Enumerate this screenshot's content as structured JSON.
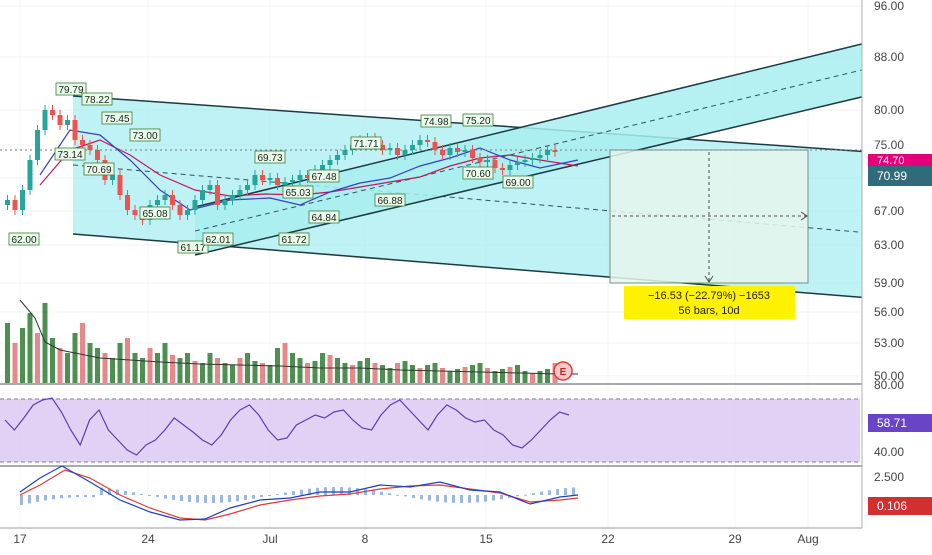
{
  "chart_data": {
    "type": "candlestick",
    "title": "",
    "price_axis": {
      "ticks": [
        "96.00",
        "88.00",
        "80.00",
        "75.00",
        "70.00",
        "67.00",
        "63.00",
        "59.00",
        "56.00",
        "53.00",
        "50.00"
      ],
      "current_price": "70.99",
      "current_price_top_label": "74.70"
    },
    "time_axis": {
      "ticks": [
        "17",
        "24",
        "Jul",
        "8",
        "15",
        "22",
        "29",
        "Aug"
      ]
    },
    "price_labels": [
      "79.79",
      "78.22",
      "75.45",
      "73.14",
      "73.00",
      "70.69",
      "69.73",
      "65.08",
      "62.00",
      "61.17",
      "62.01",
      "61.72",
      "65.03",
      "67.48",
      "64.84",
      "71.71",
      "66.88",
      "74.98",
      "75.20",
      "70.60",
      "69.00"
    ],
    "close_series": [
      [
        "2019-06-14",
        64.5
      ],
      [
        "2019-06-17",
        62.0
      ],
      [
        "2019-06-18",
        73.1
      ],
      [
        "2019-06-19",
        77.5
      ],
      [
        "2019-06-20",
        75.4
      ],
      [
        "2019-06-21",
        73.0
      ],
      [
        "2019-06-24",
        70.7
      ],
      [
        "2019-06-25",
        66.0
      ],
      [
        "2019-06-26",
        62.5
      ],
      [
        "2019-06-27",
        62.0
      ],
      [
        "2019-06-28",
        65.0
      ],
      [
        "2019-07-01",
        69.7
      ],
      [
        "2019-07-02",
        66.0
      ],
      [
        "2019-07-03",
        65.0
      ],
      [
        "2019-07-05",
        67.5
      ],
      [
        "2019-07-08",
        70.0
      ],
      [
        "2019-07-09",
        68.0
      ],
      [
        "2019-07-10",
        71.7
      ],
      [
        "2019-07-11",
        74.5
      ],
      [
        "2019-07-12",
        72.5
      ],
      [
        "2019-07-15",
        75.2
      ],
      [
        "2019-07-16",
        73.5
      ],
      [
        "2019-07-17",
        71.0
      ],
      [
        "2019-07-18",
        70.5
      ],
      [
        "2019-07-19",
        72.0
      ],
      [
        "2019-07-22",
        74.5
      ],
      [
        "2019-07-23",
        74.7
      ]
    ],
    "measure_box": {
      "line1": "−16.53 (−22.79%) −1653",
      "line2": "56 bars, 10d"
    },
    "volume": {
      "ticks": [
        "80.00"
      ],
      "marker": "E"
    },
    "rsi": {
      "ticks": [
        "58.71",
        "40.00"
      ],
      "value": "58.71"
    },
    "macd": {
      "ticks": [
        "2.500"
      ],
      "value": "0.106"
    },
    "colors": {
      "up": "#26a69a",
      "down": "#ef5350",
      "channel_fill": "#a8eef0",
      "channel_line": "#1b3b41",
      "rsi_band": "#d9c7f2",
      "measure_fill": "#e6f6ec",
      "measure_label": "#fff200",
      "price_badge": "#2f6b7a",
      "macd_badge": "#d32f2f"
    }
  }
}
